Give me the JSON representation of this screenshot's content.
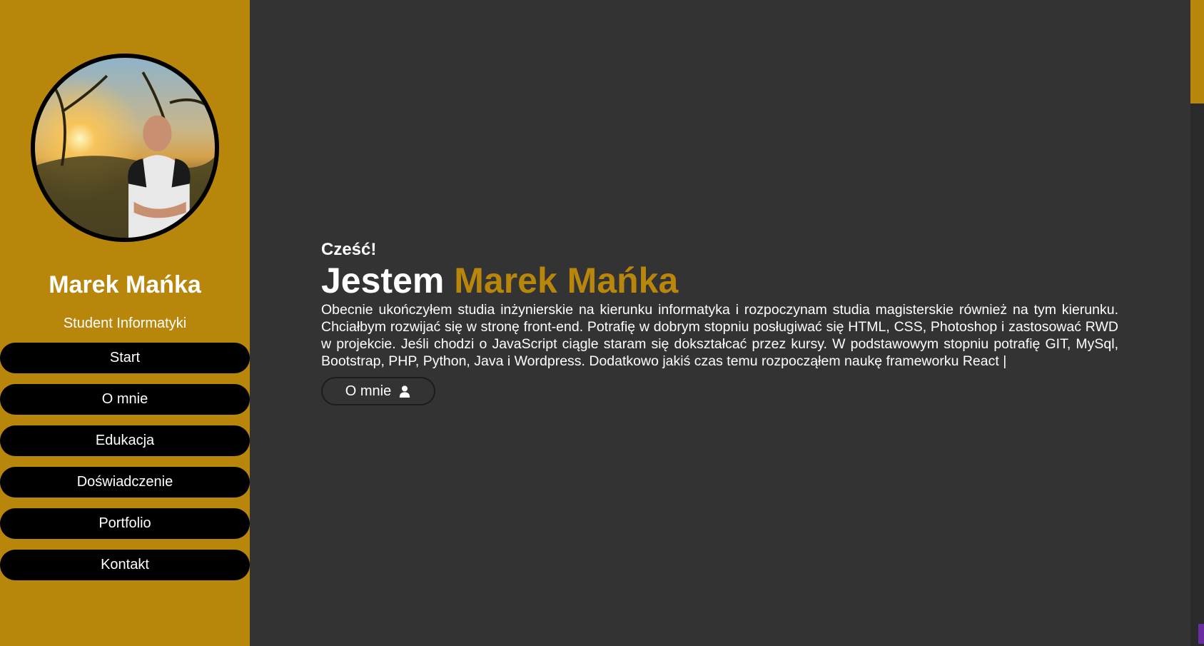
{
  "sidebar": {
    "name": "Marek Mańka",
    "subtitle": "Student Informatyki",
    "nav": [
      {
        "label": "Start"
      },
      {
        "label": "O mnie"
      },
      {
        "label": "Edukacja"
      },
      {
        "label": "Doświadczenie"
      },
      {
        "label": "Portfolio"
      },
      {
        "label": "Kontakt"
      }
    ]
  },
  "hero": {
    "greeting": "Cześć!",
    "headline_prefix": "Jestem",
    "headline_name": "Marek Mańka",
    "intro": "Obecnie ukończyłem studia inżynierskie na kierunku informatyka i rozpoczynam studia magisterskie również na tym kierunku. Chciałbym rozwijać się w stronę front-end. Potrafię w dobrym stopniu posługiwać się HTML, CSS, Photoshop i zastosować RWD w projekcie. Jeśli chodzi o JavaScript ciągle staram się dokształcać przez kursy. W podstawowym stopniu potrafię GIT, MySql, Bootstrap, PHP, Python, Java i Wordpress. Dodatkowo jakiś czas temu rozpocząłem naukę frameworku React |",
    "about_button": "O mnie",
    "about_icon": "user-icon"
  },
  "colors": {
    "accent": "#b8860b",
    "background": "#333333",
    "nav_bg": "#000000",
    "text": "#ffffff"
  }
}
